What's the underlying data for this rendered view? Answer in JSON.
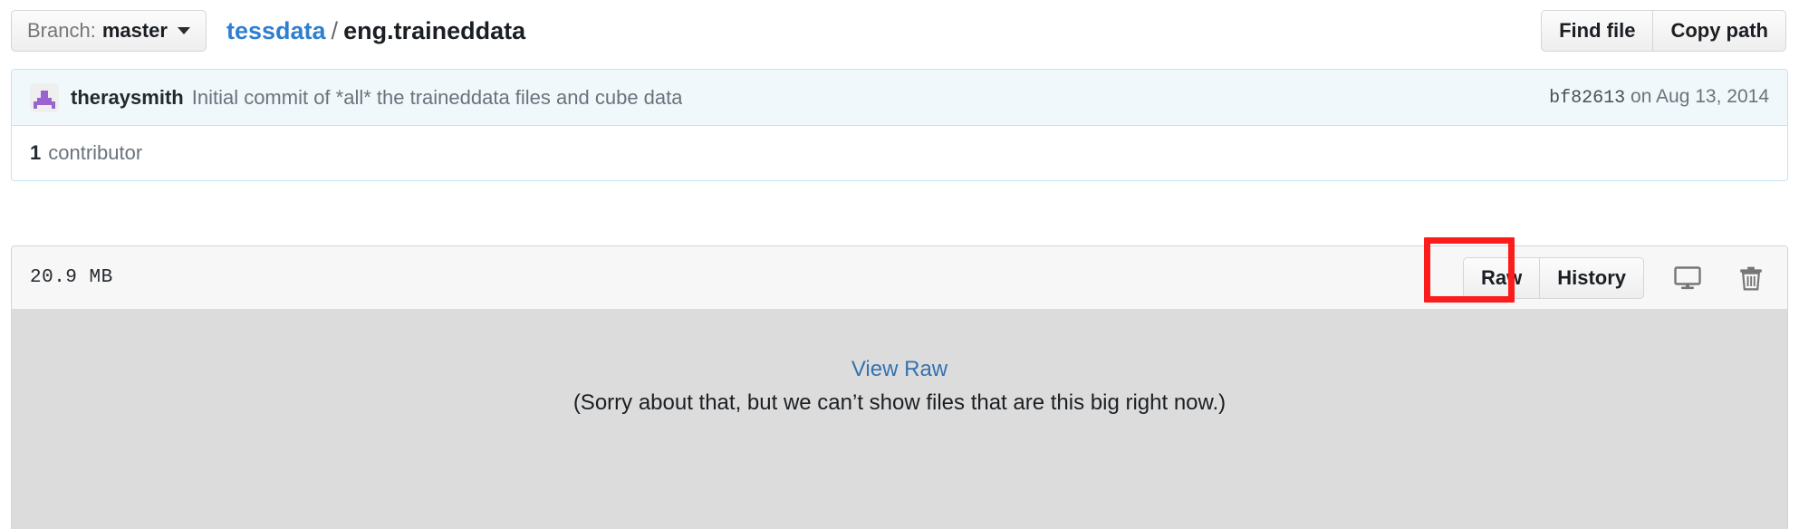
{
  "header": {
    "branch": {
      "label": "Branch:",
      "name": "master",
      "caret_icon": "chevron-down-icon"
    },
    "breadcrumb": {
      "repo": "tessdata",
      "separator": "/",
      "file": "eng.traineddata"
    },
    "actions": {
      "find_file": "Find file",
      "copy_path": "Copy path"
    }
  },
  "commit": {
    "avatar_icon": "identicon-avatar",
    "author": "theraysmith",
    "message": "Initial commit of *all* the traineddata files and cube data",
    "sha": "bf82613",
    "date": "on Aug 13, 2014",
    "contributors_count": "1",
    "contributors_label": "contributor"
  },
  "file": {
    "size": "20.9 MB",
    "actions": {
      "raw": "Raw",
      "history": "History",
      "desktop_icon": "desktop-monitor-icon",
      "delete_icon": "trash-icon"
    },
    "content": {
      "view_raw": "View Raw",
      "note": "(Sorry about that, but we can’t show files that are this big right now.)"
    }
  },
  "annotation": {
    "target": "raw-button",
    "color": "#fc1c1c"
  }
}
